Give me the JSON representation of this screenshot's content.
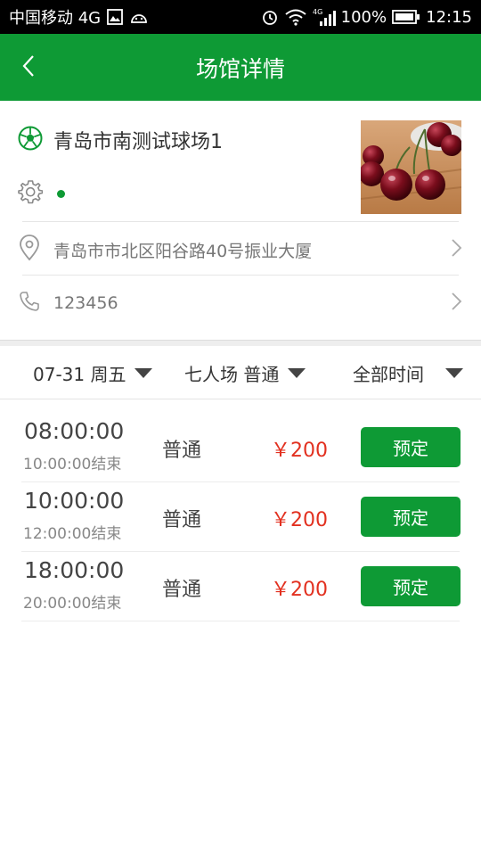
{
  "status_bar": {
    "carrier": "中国移动 4G",
    "network": "4G",
    "battery": "100%",
    "time": "12:15"
  },
  "nav": {
    "title": "场馆详情",
    "back_icon": "chevron-left-icon"
  },
  "venue": {
    "name": "青岛市南测试球场1",
    "address": "青岛市市北区阳谷路40号振业大厦",
    "phone": "123456",
    "status_color": "#0e9a35",
    "photo": "cherries"
  },
  "filters": {
    "date": "07-31 周五",
    "field_type": "七人场 普通",
    "time": "全部时间"
  },
  "slots": [
    {
      "start": "08:00:00",
      "end": "10:00:00结束",
      "type": "普通",
      "price": "￥200",
      "book": "预定"
    },
    {
      "start": "10:00:00",
      "end": "12:00:00结束",
      "type": "普通",
      "price": "￥200",
      "book": "预定"
    },
    {
      "start": "18:00:00",
      "end": "20:00:00结束",
      "type": "普通",
      "price": "￥200",
      "book": "预定"
    }
  ],
  "colors": {
    "accent": "#0e9a35",
    "price": "#e2301f"
  }
}
